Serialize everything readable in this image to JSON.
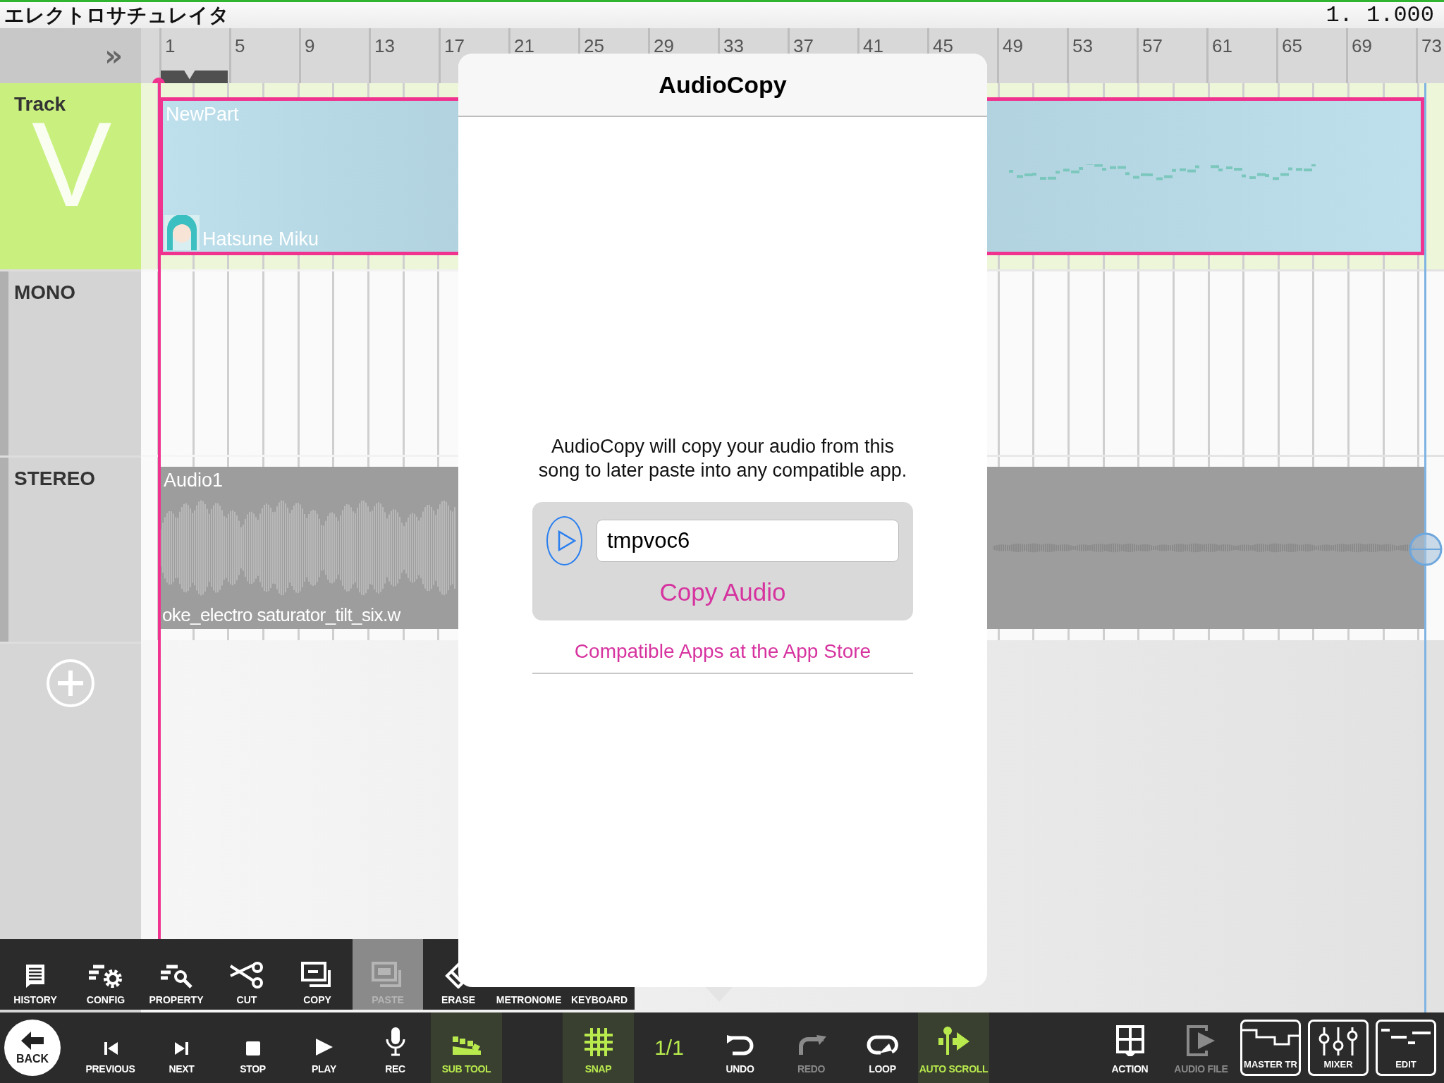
{
  "title_bar": {
    "title": "エレクトロサチュレイタ",
    "position": "1. 1.000"
  },
  "ruler": {
    "collapse_label": "»",
    "bars": [
      "1",
      "5",
      "9",
      "13",
      "17",
      "21",
      "25",
      "29",
      "33",
      "37",
      "41",
      "45",
      "49",
      "53",
      "57",
      "61",
      "65",
      "69",
      "73"
    ]
  },
  "tracks": [
    {
      "kind": "vocal",
      "name": "Track",
      "badge": "V"
    },
    {
      "kind": "mono",
      "name": "MONO"
    },
    {
      "kind": "stereo",
      "name": "STEREO"
    }
  ],
  "parts": [
    {
      "kind": "vocal",
      "name": "NewPart",
      "singer": "Hatsune Miku",
      "selected": true
    },
    {
      "kind": "audio",
      "name": "Audio1",
      "file": "oke_electro saturator_tilt_six.w",
      "selected": false
    }
  ],
  "sub_toolbar": [
    {
      "label": "HISTORY",
      "disabled": false
    },
    {
      "label": "CONFIG",
      "disabled": false
    },
    {
      "label": "PROPERTY",
      "disabled": false
    },
    {
      "label": "CUT",
      "disabled": false
    },
    {
      "label": "COPY",
      "disabled": false
    },
    {
      "label": "PASTE",
      "disabled": true
    },
    {
      "label": "ERASE",
      "disabled": false
    },
    {
      "label": "METRONOME",
      "disabled": false
    },
    {
      "label": "KEYBOARD",
      "disabled": false
    }
  ],
  "bottom_bar": [
    {
      "items": [
        {
          "kind": "back",
          "label": "BACK",
          "active": false,
          "disabled": false
        },
        {
          "kind": "tool",
          "label": "PREVIOUS",
          "active": false,
          "disabled": false
        },
        {
          "kind": "tool",
          "label": "NEXT",
          "active": false,
          "disabled": false
        },
        {
          "kind": "tool",
          "label": "STOP",
          "active": false,
          "disabled": false
        },
        {
          "kind": "tool",
          "label": "PLAY",
          "active": false,
          "disabled": false
        },
        {
          "kind": "tool",
          "label": "REC",
          "active": false,
          "disabled": false
        },
        {
          "kind": "tool",
          "label": "SUB TOOL",
          "active": true,
          "disabled": false
        }
      ]
    },
    {
      "items": [
        {
          "kind": "tool",
          "label": "SNAP",
          "active": true,
          "disabled": false
        },
        {
          "kind": "value",
          "label": "1/1",
          "active": false,
          "disabled": false
        },
        {
          "kind": "tool",
          "label": "UNDO",
          "active": false,
          "disabled": false
        },
        {
          "kind": "tool",
          "label": "REDO",
          "active": false,
          "disabled": true
        },
        {
          "kind": "tool",
          "label": "LOOP",
          "active": false,
          "disabled": false
        },
        {
          "kind": "tool",
          "label": "AUTO SCROLL",
          "active": true,
          "disabled": false
        }
      ]
    },
    {
      "items": [
        {
          "kind": "tool",
          "label": "ACTION",
          "active": false,
          "disabled": false
        },
        {
          "kind": "tool",
          "label": "AUDIO FILE",
          "active": false,
          "disabled": true
        },
        {
          "kind": "framed",
          "label": "MASTER TR",
          "active": false,
          "disabled": false
        },
        {
          "kind": "framed",
          "label": "MIXER",
          "active": false,
          "disabled": false
        },
        {
          "kind": "framed",
          "label": "EDIT",
          "active": false,
          "disabled": false
        }
      ]
    }
  ],
  "dialog": {
    "title": "AudioCopy",
    "message": "AudioCopy will copy your audio from this song to later paste into any compatible app.",
    "name_field": {
      "value": "tmpvoc6"
    },
    "copy_button": "Copy Audio",
    "link": "Compatible Apps at the App Store"
  }
}
